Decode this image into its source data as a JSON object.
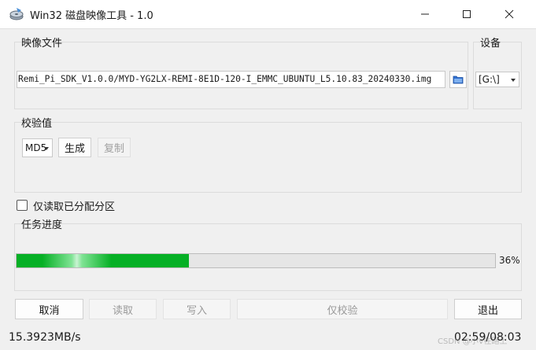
{
  "window": {
    "title": "Win32 磁盘映像工具 - 1.0",
    "controls": [
      "minimize",
      "maximize",
      "close"
    ]
  },
  "image_file": {
    "label": "映像文件",
    "path": "Remi_Pi_SDK_V1.0.0/MYD-YG2LX-REMI-8E1D-120-I_EMMC_UBUNTU_L5.10.83_20240330.img",
    "browse_icon": "folder-icon"
  },
  "device": {
    "label": "设备",
    "selected": "[G:\\]"
  },
  "checksum": {
    "label": "校验值",
    "algorithm": "MD5",
    "generate_label": "生成",
    "copy_label": "复制"
  },
  "options": {
    "read_allocated_only_label": "仅读取已分配分区",
    "read_allocated_only_checked": false
  },
  "progress": {
    "label": "任务进度",
    "value": 0.36,
    "percent_text": "36%",
    "color": "#06b025"
  },
  "actions": {
    "cancel": "取消",
    "read": "读取",
    "write": "写入",
    "verify_only": "仅校验",
    "exit": "退出"
  },
  "status": {
    "speed": "15.3923MB/s",
    "time": "02:59/08:03"
  },
  "watermark": "CSDN @小V在路上"
}
